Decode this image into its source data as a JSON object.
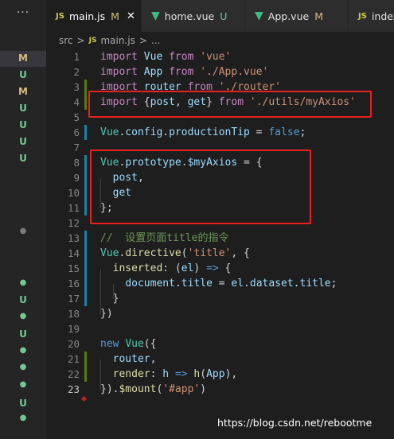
{
  "activity_bar": {
    "overflow_label": "···",
    "badges": [
      "M",
      "U",
      "M",
      "U",
      "U",
      "U",
      "U",
      "●",
      "●",
      "U",
      "●",
      "U",
      "●",
      "●",
      "●",
      "U",
      "●"
    ]
  },
  "tabs": [
    {
      "icon": "JS",
      "label": "main.js",
      "status": "M",
      "close": "✕"
    },
    {
      "icon": "vue-icon",
      "label": "home.vue",
      "status": "U"
    },
    {
      "icon": "vue-icon",
      "label": "App.vue",
      "status": "M"
    },
    {
      "icon": "JS",
      "label": "index"
    }
  ],
  "breadcrumb": {
    "folder": "src",
    "separator": ">",
    "file_icon": "JS",
    "file": "main.js",
    "ellipsis": "..."
  },
  "editor": {
    "line_numbers": [
      "1",
      "2",
      "3",
      "4",
      "5",
      "6",
      "7",
      "8",
      "9",
      "10",
      "11",
      "12",
      "13",
      "14",
      "15",
      "16",
      "17",
      "18",
      "19",
      "20",
      "21",
      "22",
      "23"
    ],
    "lines": [
      [
        [
          "kw",
          "import"
        ],
        [
          "punc",
          " "
        ],
        [
          "id",
          "Vue"
        ],
        [
          "punc",
          " "
        ],
        [
          "kw",
          "from"
        ],
        [
          "punc",
          " "
        ],
        [
          "str",
          "'vue'"
        ]
      ],
      [
        [
          "kw",
          "import"
        ],
        [
          "punc",
          " "
        ],
        [
          "id",
          "App"
        ],
        [
          "punc",
          " "
        ],
        [
          "kw",
          "from"
        ],
        [
          "punc",
          " "
        ],
        [
          "str",
          "'./App.vue'"
        ]
      ],
      [
        [
          "kw",
          "import"
        ],
        [
          "punc",
          " "
        ],
        [
          "id",
          "router"
        ],
        [
          "punc",
          " "
        ],
        [
          "kw",
          "from"
        ],
        [
          "punc",
          " "
        ],
        [
          "str",
          "'./router'"
        ]
      ],
      [
        [
          "kw",
          "import"
        ],
        [
          "punc",
          " {"
        ],
        [
          "id",
          "post"
        ],
        [
          "punc",
          ", "
        ],
        [
          "id",
          "get"
        ],
        [
          "punc",
          "} "
        ],
        [
          "kw",
          "from"
        ],
        [
          "punc",
          " "
        ],
        [
          "str",
          "'./utils/myAxios'"
        ]
      ],
      [],
      [
        [
          "cls",
          "Vue"
        ],
        [
          "punc",
          "."
        ],
        [
          "id",
          "config"
        ],
        [
          "punc",
          "."
        ],
        [
          "id",
          "productionTip"
        ],
        [
          "punc",
          " = "
        ],
        [
          "kw2",
          "false"
        ],
        [
          "punc",
          ";"
        ]
      ],
      [],
      [
        [
          "cls",
          "Vue"
        ],
        [
          "punc",
          "."
        ],
        [
          "id",
          "prototype"
        ],
        [
          "punc",
          "."
        ],
        [
          "id",
          "$myAxios"
        ],
        [
          "punc",
          " = {"
        ]
      ],
      [
        [
          "punc",
          "  "
        ],
        [
          "id",
          "post"
        ],
        [
          "punc",
          ","
        ]
      ],
      [
        [
          "punc",
          "  "
        ],
        [
          "id",
          "get"
        ]
      ],
      [
        [
          "punc",
          "};"
        ]
      ],
      [],
      [
        [
          "cmt",
          "//  设置页面title的指令"
        ]
      ],
      [
        [
          "cls",
          "Vue"
        ],
        [
          "punc",
          "."
        ],
        [
          "fn",
          "directive"
        ],
        [
          "punc",
          "("
        ],
        [
          "str",
          "'title'"
        ],
        [
          "punc",
          ", {"
        ]
      ],
      [
        [
          "punc",
          "  "
        ],
        [
          "fn",
          "inserted"
        ],
        [
          "punc",
          ": ("
        ],
        [
          "id",
          "el"
        ],
        [
          "punc",
          ") "
        ],
        [
          "kw2",
          "=>"
        ],
        [
          "punc",
          " {"
        ]
      ],
      [
        [
          "punc",
          "    "
        ],
        [
          "id",
          "document"
        ],
        [
          "punc",
          "."
        ],
        [
          "id",
          "title"
        ],
        [
          "punc",
          " = "
        ],
        [
          "id",
          "el"
        ],
        [
          "punc",
          "."
        ],
        [
          "id",
          "dataset"
        ],
        [
          "punc",
          "."
        ],
        [
          "id",
          "title"
        ],
        [
          "punc",
          ";"
        ]
      ],
      [
        [
          "punc",
          "  }"
        ]
      ],
      [
        [
          "punc",
          "})"
        ]
      ],
      [],
      [
        [
          "kw2",
          "new"
        ],
        [
          "punc",
          " "
        ],
        [
          "cls",
          "Vue"
        ],
        [
          "punc",
          "({"
        ]
      ],
      [
        [
          "punc",
          "  "
        ],
        [
          "id",
          "router"
        ],
        [
          "punc",
          ","
        ]
      ],
      [
        [
          "punc",
          "  "
        ],
        [
          "fn",
          "render"
        ],
        [
          "punc",
          ": "
        ],
        [
          "id",
          "h"
        ],
        [
          "punc",
          " "
        ],
        [
          "kw2",
          "=>"
        ],
        [
          "punc",
          " "
        ],
        [
          "fn",
          "h"
        ],
        [
          "punc",
          "("
        ],
        [
          "id",
          "App"
        ],
        [
          "punc",
          "),"
        ]
      ],
      [
        [
          "punc",
          "})."
        ],
        [
          "fn",
          "$mount"
        ],
        [
          "punc",
          "("
        ],
        [
          "str",
          "'#app'"
        ],
        [
          "punc",
          ")"
        ]
      ]
    ]
  },
  "watermark": "https://blog.csdn.net/rebootme"
}
